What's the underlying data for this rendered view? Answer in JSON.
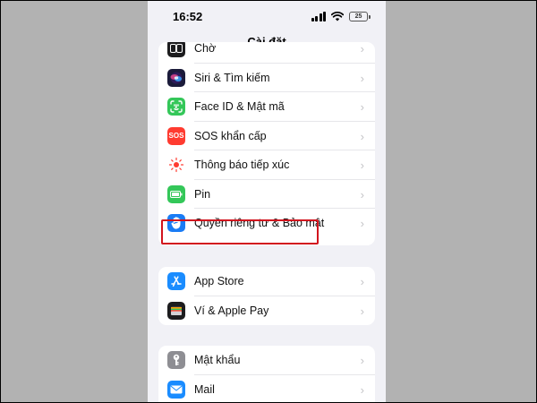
{
  "status_bar": {
    "time": "16:52",
    "battery": "25"
  },
  "nav": {
    "title": "Cài đặt"
  },
  "groups": [
    {
      "items": [
        {
          "label": "Chờ",
          "icon": "standby-icon"
        },
        {
          "label": "Siri & Tìm kiếm",
          "icon": "siri-icon"
        },
        {
          "label": "Face ID & Mật mã",
          "icon": "face-id-icon"
        },
        {
          "label": "SOS khẩn cấp",
          "icon": "sos-icon",
          "icon_text": "SOS"
        },
        {
          "label": "Thông báo tiếp xúc",
          "icon": "exposure-notification-icon"
        },
        {
          "label": "Pin",
          "icon": "battery-icon"
        },
        {
          "label": "Quyền riêng tư & Bảo mật",
          "icon": "privacy-hand-icon",
          "highlighted": true
        }
      ]
    },
    {
      "items": [
        {
          "label": "App Store",
          "icon": "app-store-icon"
        },
        {
          "label": "Ví & Apple Pay",
          "icon": "wallet-icon"
        }
      ]
    },
    {
      "items": [
        {
          "label": "Mật khẩu",
          "icon": "key-icon"
        },
        {
          "label": "Mail",
          "icon": "mail-icon"
        }
      ]
    }
  ],
  "chevron": "›",
  "colors": {
    "background": "#f1f1f6",
    "highlight_border": "#d2141e",
    "siri": "#1b1b3a",
    "face_id": "#34c759",
    "sos": "#ff3b30",
    "battery": "#34c759",
    "privacy": "#1a7cf5",
    "app_store": "#1a8cff",
    "wallet": "#1c1c1e",
    "passwords": "#8e8e93",
    "mail": "#1a8cff"
  }
}
